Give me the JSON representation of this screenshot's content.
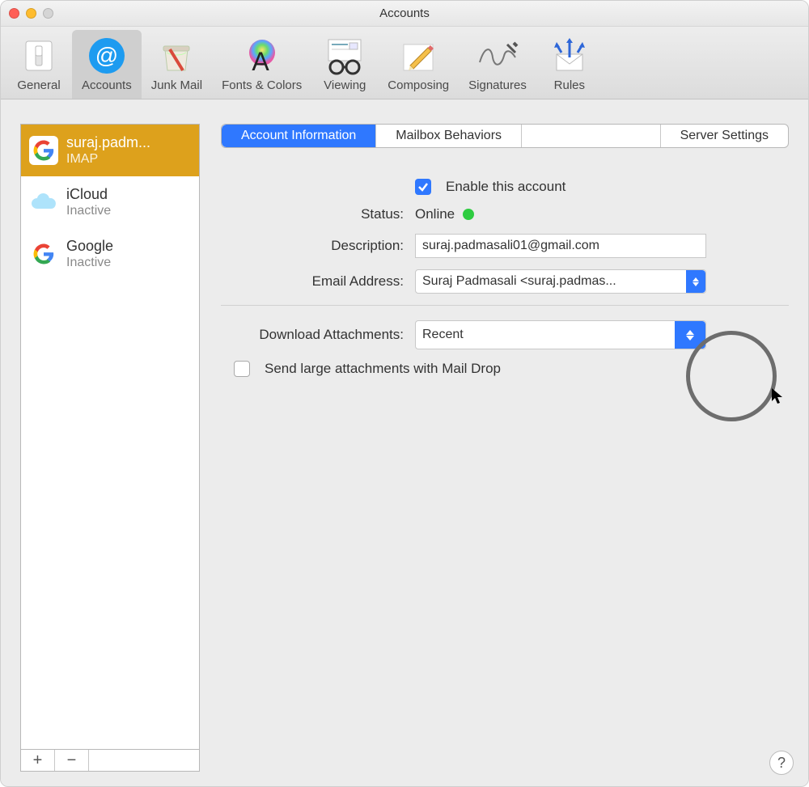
{
  "window": {
    "title": "Accounts"
  },
  "toolbar": {
    "items": [
      {
        "label": "General"
      },
      {
        "label": "Accounts"
      },
      {
        "label": "Junk Mail"
      },
      {
        "label": "Fonts & Colors"
      },
      {
        "label": "Viewing"
      },
      {
        "label": "Composing"
      },
      {
        "label": "Signatures"
      },
      {
        "label": "Rules"
      }
    ]
  },
  "sidebar": {
    "items": [
      {
        "name": "suraj.padm...",
        "sub": "IMAP"
      },
      {
        "name": "iCloud",
        "sub": "Inactive"
      },
      {
        "name": "Google",
        "sub": "Inactive"
      }
    ],
    "add": "+",
    "remove": "−"
  },
  "tabs": [
    {
      "label": "Account Information"
    },
    {
      "label": "Mailbox Behaviors"
    },
    {
      "label": "Server Settings"
    }
  ],
  "form": {
    "enable_label": "Enable this account",
    "status_label": "Status:",
    "status_value": "Online",
    "description_label": "Description:",
    "description_value": "suraj.padmasali01@gmail.com",
    "email_label": "Email Address:",
    "email_value": "Suraj Padmasali <suraj.padmas...",
    "download_label": "Download Attachments:",
    "download_value": "Recent",
    "maildrop_label": "Send large attachments with Mail Drop"
  },
  "help": "?"
}
